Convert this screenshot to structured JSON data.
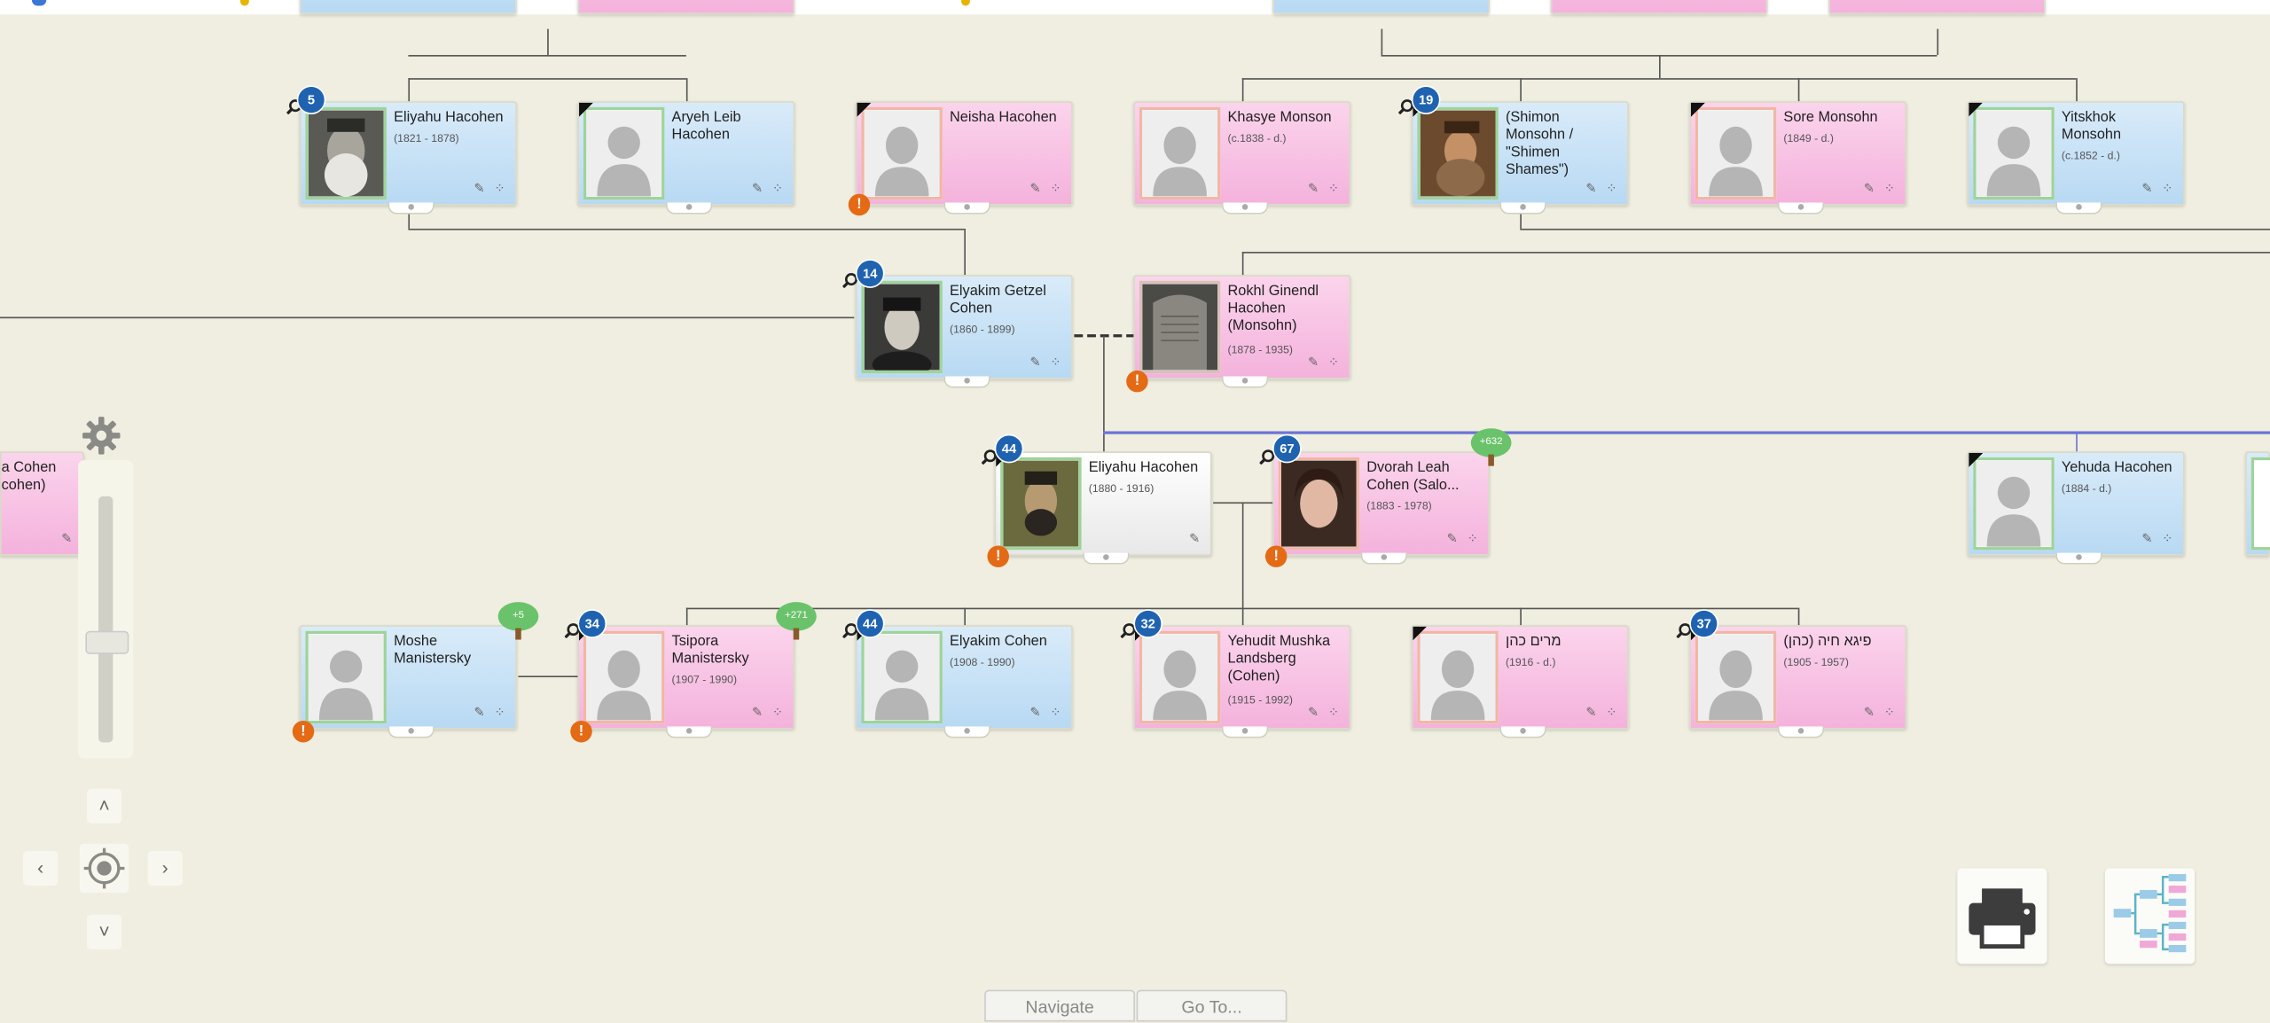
{
  "people": {
    "eliyahu_1821": {
      "name": "Eliyahu Hacohen",
      "years": "(1821 - 1878)",
      "badge": "5"
    },
    "aryeh_leib": {
      "name": "Aryeh Leib Hacohen",
      "years": ""
    },
    "neisha": {
      "name": "Neisha Hacohen",
      "years": ""
    },
    "khasye": {
      "name": "Khasye Monson",
      "years": "(c.1838 - d.)"
    },
    "shimon": {
      "name": "(Shimon Monsohn / \"Shimen Shames\")",
      "years": "",
      "badge": "19"
    },
    "sore": {
      "name": "Sore Monsohn",
      "years": "(1849 - d.)"
    },
    "yitskhok": {
      "name": "Yitskhok Monsohn",
      "years": "(c.1852 - d.)"
    },
    "elyakim_getzel": {
      "name": "Elyakim Getzel Cohen",
      "years": "(1860 - 1899)",
      "badge": "14"
    },
    "rokhl": {
      "name": "Rokhl Ginendl Hacohen (Monsohn)",
      "years": "(1878 - 1935)"
    },
    "eliyahu_1880": {
      "name": "Eliyahu Hacohen",
      "years": "(1880 - 1916)",
      "badge": "44"
    },
    "dvorah": {
      "name": "Dvorah Leah Cohen (Salo...",
      "years": "(1883 - 1978)",
      "badge": "67",
      "tree": "+632"
    },
    "yehuda": {
      "name": "Yehuda Hacohen",
      "years": "(1884 - d.)"
    },
    "partial_left": {
      "name": "a Cohen cohen)"
    },
    "moshe": {
      "name": "Moshe Manistersky",
      "years": "",
      "tree": "+5"
    },
    "tsipora": {
      "name": "Tsipora Manistersky",
      "years": "(1907 - 1990)",
      "badge": "34",
      "tree": "+271"
    },
    "elyakim_1908": {
      "name": "Elyakim Cohen",
      "years": "(1908 - 1990)",
      "badge": "44"
    },
    "yehudit": {
      "name": "Yehudit Mushka Landsberg (Cohen)",
      "years": "(1915 - 1992)",
      "badge": "32"
    },
    "miriam": {
      "name": "מרים כהן",
      "years": "(1916 - d.)"
    },
    "chaya": {
      "name": "(כהן) פיגא חיה",
      "years": "(1905 - 1957)",
      "badge": "37"
    }
  },
  "controls": {
    "up": "˄",
    "down": "˅",
    "left": "‹",
    "right": "›",
    "navigate": "Navigate",
    "goto": "Go To..."
  },
  "icons": {
    "settings": "gear-icon",
    "center": "target-icon",
    "print": "printer-icon",
    "tree_view": "family-tree-icon"
  },
  "colors": {
    "male_card": "#c6e1f6",
    "female_card": "#f7bfe3",
    "badge": "#1f63b0",
    "warning": "#e46a16",
    "tree": "#6ac36b"
  }
}
